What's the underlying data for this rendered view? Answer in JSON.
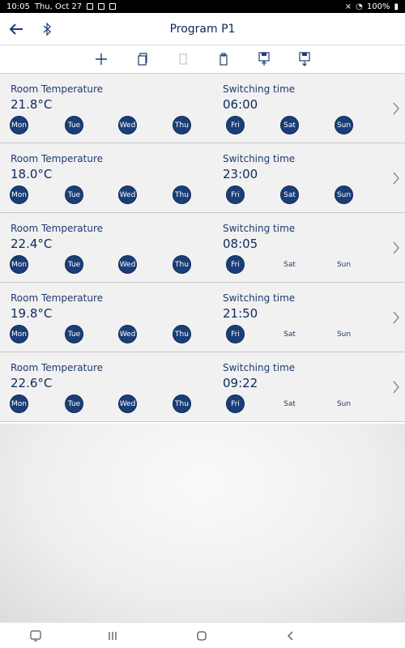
{
  "status": {
    "time": "10:05",
    "date": "Thu, Oct 27",
    "battery": "100%"
  },
  "header": {
    "title": "Program P1"
  },
  "labels": {
    "temp": "Room Temperature",
    "time": "Switching time"
  },
  "days": [
    "Mon",
    "Tue",
    "Wed",
    "Thu",
    "Fri",
    "Sat",
    "Sun"
  ],
  "rows": [
    {
      "temperature": "21.8°C",
      "switching_time": "06:00",
      "active": [
        true,
        true,
        true,
        true,
        true,
        true,
        true
      ]
    },
    {
      "temperature": "18.0°C",
      "switching_time": "23:00",
      "active": [
        true,
        true,
        true,
        true,
        true,
        true,
        true
      ]
    },
    {
      "temperature": "22.4°C",
      "switching_time": "08:05",
      "active": [
        true,
        true,
        true,
        true,
        true,
        false,
        false
      ]
    },
    {
      "temperature": "19.8°C",
      "switching_time": "21:50",
      "active": [
        true,
        true,
        true,
        true,
        true,
        false,
        false
      ]
    },
    {
      "temperature": "22.6°C",
      "switching_time": "09:22",
      "active": [
        true,
        true,
        true,
        true,
        true,
        false,
        false
      ]
    }
  ],
  "icons": {
    "back": "back-arrow-icon",
    "bluetooth": "bluetooth-icon",
    "add": "plus-icon",
    "copy": "copy-icon",
    "paste": "paste-icon",
    "clipboard": "clipboard-icon",
    "upload": "save-upload-icon",
    "download": "save-download-icon",
    "chevron": "chevron-right-icon"
  },
  "colors": {
    "accent": "#1a3e78",
    "text": "#0b2a5a"
  }
}
